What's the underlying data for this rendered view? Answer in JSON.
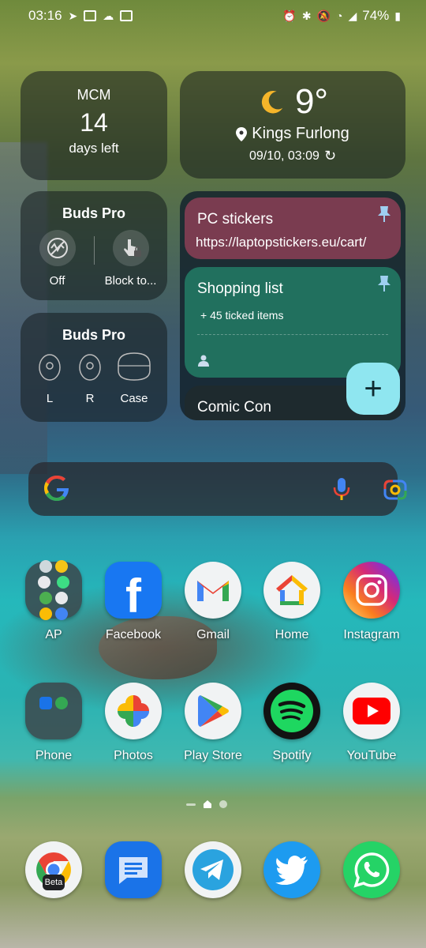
{
  "status_bar": {
    "time": "03:16",
    "battery": "74%"
  },
  "countdown_widget": {
    "title": "MCM",
    "number": "14",
    "subtitle": "days left"
  },
  "weather_widget": {
    "temperature": "9°",
    "location": "Kings Furlong",
    "updated": "09/10, 03:09"
  },
  "buds_controls": {
    "title": "Buds Pro",
    "options": [
      {
        "label": "Off"
      },
      {
        "label": "Block to..."
      }
    ]
  },
  "buds_battery": {
    "title": "Buds Pro",
    "items": [
      {
        "label": "L"
      },
      {
        "label": "R"
      },
      {
        "label": "Case"
      }
    ]
  },
  "notes_widget": {
    "notes": [
      {
        "title": "PC stickers",
        "body": "https://laptopstickers.eu/cart/",
        "color": "#7a3c50"
      },
      {
        "title": "Shopping list",
        "body": "+ 45 ticked items",
        "color": "#21705e"
      },
      {
        "title": "Comic Con",
        "color": "#1e2a2e"
      }
    ],
    "fab_label": "+"
  },
  "home_apps": {
    "row1": [
      {
        "label": "AP",
        "icon": "folder-icon"
      },
      {
        "label": "Facebook",
        "icon": "facebook-icon"
      },
      {
        "label": "Gmail",
        "icon": "gmail-icon"
      },
      {
        "label": "Home",
        "icon": "google-home-icon"
      },
      {
        "label": "Instagram",
        "icon": "instagram-icon"
      }
    ],
    "row2": [
      {
        "label": "Phone",
        "icon": "folder-icon"
      },
      {
        "label": "Photos",
        "icon": "google-photos-icon"
      },
      {
        "label": "Play Store",
        "icon": "play-store-icon"
      },
      {
        "label": "Spotify",
        "icon": "spotify-icon"
      },
      {
        "label": "YouTube",
        "icon": "youtube-icon"
      }
    ]
  },
  "dock": {
    "chrome_badge": "Beta",
    "apps": [
      {
        "icon": "chrome-beta-icon"
      },
      {
        "icon": "messages-icon"
      },
      {
        "icon": "telegram-icon"
      },
      {
        "icon": "twitter-icon"
      },
      {
        "icon": "whatsapp-icon"
      }
    ]
  },
  "colors": {
    "fab": "#8fe6f0",
    "note_pink": "#7a3c50",
    "note_green": "#21705e"
  }
}
